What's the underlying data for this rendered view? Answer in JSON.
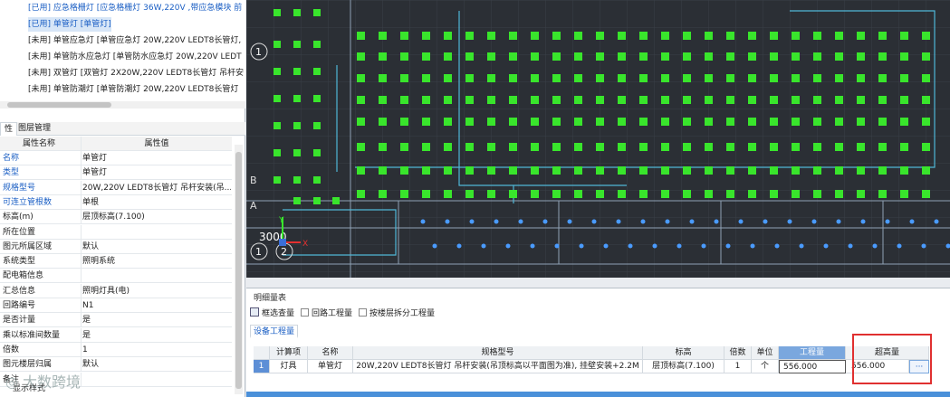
{
  "tree": {
    "items": [
      {
        "label": "[已用] 应急格栅灯 [应急格栅灯 36W,220V ,带应急模块 前",
        "status": "used",
        "selected": false
      },
      {
        "label": "[已用] 单管灯 [单管灯]",
        "status": "used",
        "selected": true
      },
      {
        "label": "[未用] 单管应急灯 [单管应急灯 20W,220V LEDT8长管灯,",
        "status": "unused",
        "selected": false
      },
      {
        "label": "[未用] 单管防水应急灯 [单管防水应急灯 20W,220V LEDT",
        "status": "unused",
        "selected": false
      },
      {
        "label": "[未用] 双管灯 [双管灯 2X20W,220V LEDT8长管灯 吊杆安",
        "status": "unused",
        "selected": false
      },
      {
        "label": "[未用] 单管防潮灯 [单管防潮灯 20W,220V LEDT8长管灯",
        "status": "unused",
        "selected": false
      }
    ]
  },
  "tabs": {
    "properties": "性",
    "layers": "图层管理"
  },
  "props": {
    "header": {
      "name": "属性名称",
      "value": "属性值"
    },
    "rows": [
      {
        "name": "名称",
        "value": "单管灯",
        "blue": true
      },
      {
        "name": "类型",
        "value": "单管灯",
        "blue": true
      },
      {
        "name": "规格型号",
        "value": "20W,220V   LEDT8长管灯 吊杆安装(吊...",
        "blue": true
      },
      {
        "name": "可连立管根数",
        "value": "单根",
        "blue": true
      },
      {
        "name": "标高(m)",
        "value": "层顶标高(7.100)",
        "blue": false
      },
      {
        "name": "所在位置",
        "value": "",
        "blue": false
      },
      {
        "name": "图元所属区域",
        "value": "默认",
        "blue": false
      },
      {
        "name": "系统类型",
        "value": "照明系统",
        "blue": false
      },
      {
        "name": "配电箱信息",
        "value": "",
        "blue": false
      },
      {
        "name": "汇总信息",
        "value": "照明灯具(电)",
        "blue": false
      },
      {
        "name": "回路编号",
        "value": "N1",
        "blue": false
      },
      {
        "name": "是否计量",
        "value": "是",
        "blue": false
      },
      {
        "name": "乘以标准间数量",
        "value": "是",
        "blue": false
      },
      {
        "name": "倍数",
        "value": "1",
        "blue": false
      },
      {
        "name": "图元楼层归属",
        "value": "默认",
        "blue": false
      },
      {
        "name": "备注",
        "value": "",
        "blue": false
      }
    ],
    "style_label": "显示样式"
  },
  "watermark": "◎ 大数跨境",
  "cad": {
    "labels": {
      "n1": "1",
      "n1b": "1",
      "n2": "2",
      "a": "A",
      "b": "B",
      "coord": "3000",
      "y": "Y",
      "x": "X"
    }
  },
  "bottom": {
    "panel_title": "明细量表",
    "toolbar": {
      "select": "框选查量",
      "circuit": "回路工程量",
      "floor_split": "按楼层拆分工程量"
    },
    "subtab": "设备工程量",
    "columns": [
      "计算项",
      "名称",
      "规格型号",
      "标高",
      "倍数",
      "单位",
      "工程量",
      "超高量"
    ],
    "rows": [
      {
        "num": "1",
        "calc": "灯具",
        "name": "单管灯",
        "spec": "20W,220V   LEDT8长管灯 吊杆安装(吊顶标高以平面图为准), 挂壁安装+2.2M",
        "height": "层顶标高(7.100)",
        "multiple": "1",
        "unit": "个",
        "qty": "556.000",
        "over": "556.000",
        "more": "···"
      }
    ]
  },
  "colors": {
    "light": "#39e52c",
    "cad_bg": "#2b2f35",
    "accent": "#1b5fc4",
    "highlight_box": "#e03030"
  }
}
